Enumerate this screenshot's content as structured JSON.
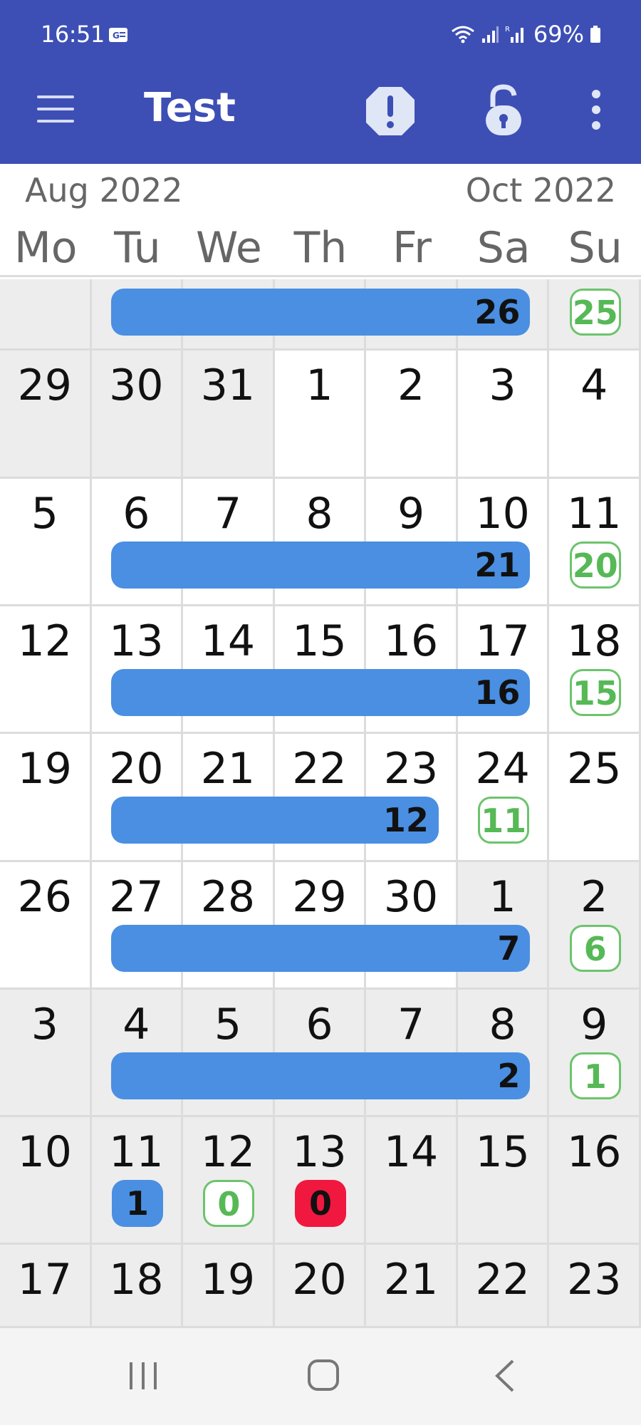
{
  "status_bar": {
    "time": "16:51",
    "battery": "69%"
  },
  "app_bar": {
    "title": "Test",
    "icons": [
      "menu-icon",
      "alert-icon",
      "unlocked-icon",
      "more-vertical-icon"
    ]
  },
  "calendar": {
    "month_left": "Aug 2022",
    "month_right": "Oct 2022",
    "weekdays": [
      "Mo",
      "Tu",
      "We",
      "Th",
      "Fr",
      "Sa",
      "Su"
    ],
    "colors": {
      "bar_blue": "#4a8fe2",
      "badge_green": "#56b956",
      "badge_red": "#f0183f",
      "grey_cell": "#ededed",
      "appbar": "#3d4fb5"
    },
    "rows": [
      {
        "days": [
          "",
          "",
          "",
          "",
          "",
          "",
          ""
        ],
        "shade": [
          "g",
          "g",
          "g",
          "g",
          "g",
          "g",
          "g"
        ],
        "bar": {
          "start": 1,
          "end": 5,
          "label": "26"
        },
        "badges": [
          {
            "col": 6,
            "label": "25",
            "style": "green"
          }
        ]
      },
      {
        "days": [
          "29",
          "30",
          "31",
          "1",
          "2",
          "3",
          "4"
        ],
        "shade": [
          "g",
          "g",
          "g",
          "w",
          "w",
          "w",
          "w"
        ],
        "bar": null,
        "badges": []
      },
      {
        "days": [
          "5",
          "6",
          "7",
          "8",
          "9",
          "10",
          "11"
        ],
        "shade": [
          "w",
          "w",
          "w",
          "w",
          "w",
          "w",
          "w"
        ],
        "bar": {
          "start": 1,
          "end": 5,
          "label": "21"
        },
        "badges": [
          {
            "col": 6,
            "label": "20",
            "style": "green"
          }
        ]
      },
      {
        "days": [
          "12",
          "13",
          "14",
          "15",
          "16",
          "17",
          "18"
        ],
        "shade": [
          "w",
          "w",
          "w",
          "w",
          "w",
          "w",
          "w"
        ],
        "bar": {
          "start": 1,
          "end": 5,
          "label": "16"
        },
        "badges": [
          {
            "col": 6,
            "label": "15",
            "style": "green"
          }
        ]
      },
      {
        "days": [
          "19",
          "20",
          "21",
          "22",
          "23",
          "24",
          "25"
        ],
        "shade": [
          "w",
          "w",
          "w",
          "w",
          "w",
          "w",
          "w"
        ],
        "bar": {
          "start": 1,
          "end": 4,
          "label": "12"
        },
        "badges": [
          {
            "col": 5,
            "label": "11",
            "style": "green"
          }
        ]
      },
      {
        "days": [
          "26",
          "27",
          "28",
          "29",
          "30",
          "1",
          "2"
        ],
        "shade": [
          "w",
          "w",
          "w",
          "w",
          "w",
          "g",
          "g"
        ],
        "bar": {
          "start": 1,
          "end": 5,
          "label": "7"
        },
        "badges": [
          {
            "col": 6,
            "label": "6",
            "style": "green"
          }
        ]
      },
      {
        "days": [
          "3",
          "4",
          "5",
          "6",
          "7",
          "8",
          "9"
        ],
        "shade": [
          "g",
          "g",
          "g",
          "g",
          "g",
          "g",
          "g"
        ],
        "bar": {
          "start": 1,
          "end": 5,
          "label": "2"
        },
        "badges": [
          {
            "col": 6,
            "label": "1",
            "style": "green"
          }
        ]
      },
      {
        "days": [
          "10",
          "11",
          "12",
          "13",
          "14",
          "15",
          "16"
        ],
        "shade": [
          "g",
          "g",
          "g",
          "g",
          "g",
          "g",
          "g"
        ],
        "bar": null,
        "badges": [
          {
            "col": 1,
            "label": "1",
            "style": "blue"
          },
          {
            "col": 2,
            "label": "0",
            "style": "green"
          },
          {
            "col": 3,
            "label": "0",
            "style": "red"
          }
        ]
      },
      {
        "days": [
          "17",
          "18",
          "19",
          "20",
          "21",
          "22",
          "23"
        ],
        "shade": [
          "g",
          "g",
          "g",
          "g",
          "g",
          "g",
          "g"
        ],
        "bar": null,
        "badges": []
      }
    ]
  },
  "nav_bar": {
    "icons": [
      "recents-icon",
      "home-icon",
      "back-icon"
    ]
  }
}
